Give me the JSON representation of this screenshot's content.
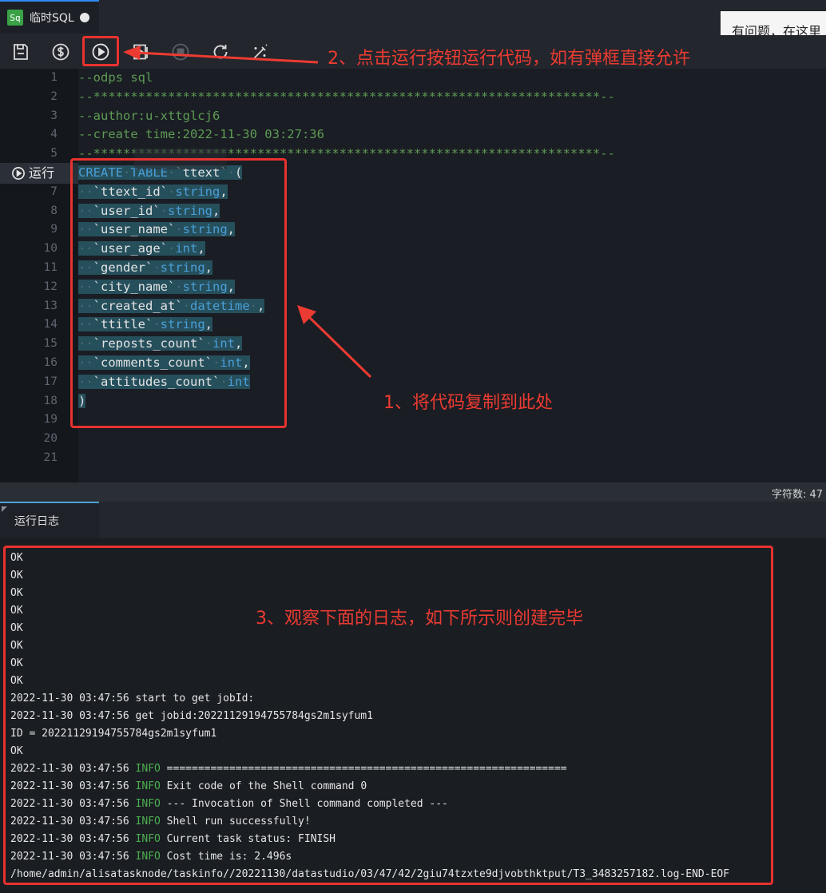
{
  "tab": {
    "icon_text": "Sq",
    "title": "临时SQL"
  },
  "help_text": "有问题，在这里",
  "annotations": {
    "step1": "1、将代码复制到此处",
    "step2": "2、点击运行按钮运行代码，如有弹框直接允许",
    "step3": "3、观察下面的日志，如下所示则创建完毕"
  },
  "toolbar": {
    "save": "save-icon",
    "cost": "dollar-icon",
    "run": "play-icon",
    "run_selected": "play-square-icon",
    "stop": "stop-icon",
    "reload": "refresh-icon",
    "format": "magic-wand-icon"
  },
  "tooltip_ghost": "",
  "editor": {
    "run_label": "运行",
    "lines": [
      {
        "n": "1",
        "text": "--odps sql"
      },
      {
        "n": "2",
        "text": "--********************************************************************--"
      },
      {
        "n": "3",
        "text": "--author:u-xttglcj6"
      },
      {
        "n": "4",
        "text": "--create time:2022-11-30 03:27:36"
      },
      {
        "n": "5",
        "text": "--********************************************************************--"
      },
      {
        "n": "6",
        "text": "CREATE TABLE `ttext` ("
      },
      {
        "n": "7",
        "text": "`ttext_id` string,"
      },
      {
        "n": "8",
        "text": "`user_id` string,"
      },
      {
        "n": "9",
        "text": "`user_name` string,"
      },
      {
        "n": "10",
        "text": "`user_age` int,"
      },
      {
        "n": "11",
        "text": "`gender` string,"
      },
      {
        "n": "12",
        "text": "`city_name` string,"
      },
      {
        "n": "13",
        "text": "`created_at` datetime ,"
      },
      {
        "n": "14",
        "text": "`ttitle` string,"
      },
      {
        "n": "15",
        "text": "`reposts_count` int,"
      },
      {
        "n": "16",
        "text": "`comments_count` int,"
      },
      {
        "n": "17",
        "text": "`attitudes_count` int"
      },
      {
        "n": "18",
        "text": ")"
      },
      {
        "n": "19",
        "text": ""
      },
      {
        "n": "20",
        "text": ""
      },
      {
        "n": "21",
        "text": ""
      }
    ]
  },
  "statusbar": {
    "char_count": "字符数: 47"
  },
  "log": {
    "tab_label": "运行日志",
    "lines": [
      {
        "pre": "OK",
        "info": "",
        "post": ""
      },
      {
        "pre": "OK",
        "info": "",
        "post": ""
      },
      {
        "pre": "OK",
        "info": "",
        "post": ""
      },
      {
        "pre": "OK",
        "info": "",
        "post": ""
      },
      {
        "pre": "OK",
        "info": "",
        "post": ""
      },
      {
        "pre": "OK",
        "info": "",
        "post": ""
      },
      {
        "pre": "OK",
        "info": "",
        "post": ""
      },
      {
        "pre": "OK",
        "info": "",
        "post": ""
      },
      {
        "pre": "2022-11-30 03:47:56 start to get jobId:",
        "info": "",
        "post": ""
      },
      {
        "pre": "2022-11-30 03:47:56 get jobid:20221129194755784gs2m1syfum1",
        "info": "",
        "post": ""
      },
      {
        "pre": "ID = 20221129194755784gs2m1syfum1",
        "info": "",
        "post": ""
      },
      {
        "pre": "OK",
        "info": "",
        "post": ""
      },
      {
        "pre": "2022-11-30 03:47:56 ",
        "info": "INFO",
        "post": " ================================================================"
      },
      {
        "pre": "2022-11-30 03:47:56 ",
        "info": "INFO",
        "post": " Exit code of the Shell command 0"
      },
      {
        "pre": "2022-11-30 03:47:56 ",
        "info": "INFO",
        "post": " --- Invocation of Shell command completed ---"
      },
      {
        "pre": "2022-11-30 03:47:56 ",
        "info": "INFO",
        "post": " Shell run successfully!"
      },
      {
        "pre": "2022-11-30 03:47:56 ",
        "info": "INFO",
        "post": " Current task status: FINISH"
      },
      {
        "pre": "2022-11-30 03:47:56 ",
        "info": "INFO",
        "post": " Cost time is: 2.496s"
      },
      {
        "pre": "/home/admin/alisatasknode/taskinfo//20221130/datastudio/03/47/42/2giu74tzxte9djvobthktput/T3_3483257182.log-END-EOF",
        "info": "",
        "post": ""
      }
    ]
  },
  "colors": {
    "annotation_red": "#e9322f",
    "info_green": "#4caf50",
    "keyword_blue": "#4a9fd8",
    "comment_green": "#5e9b55"
  }
}
